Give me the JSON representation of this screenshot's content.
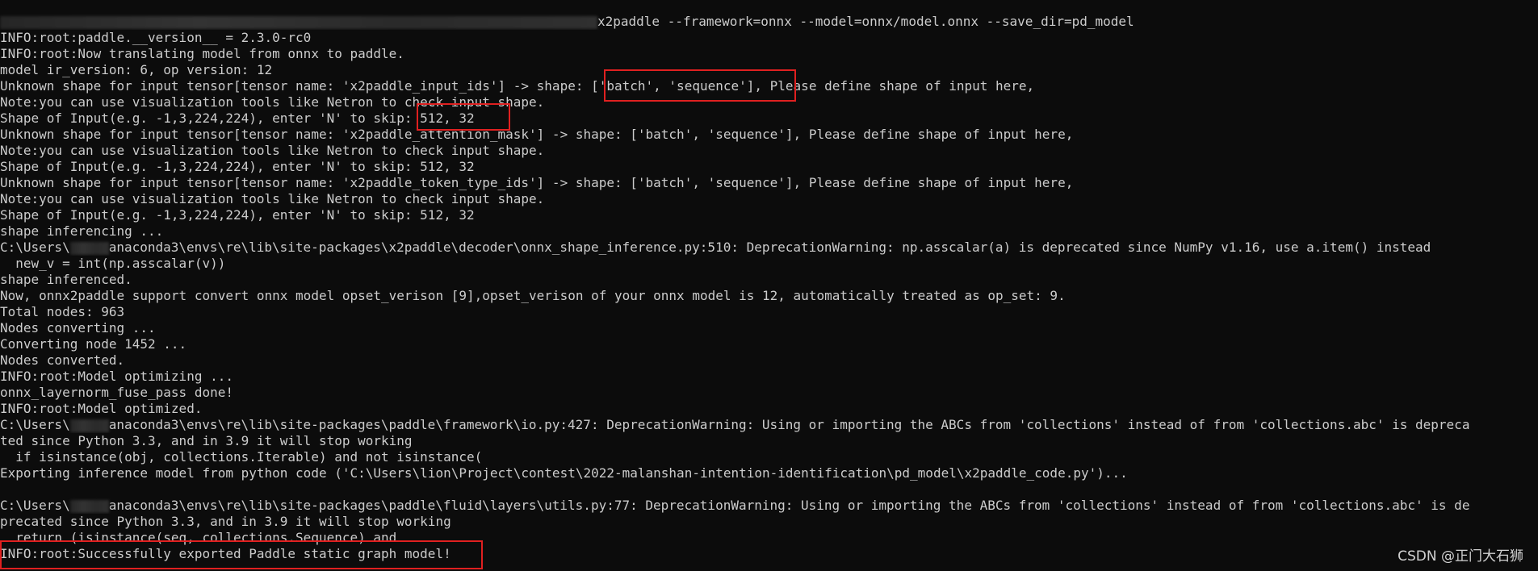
{
  "terminal": {
    "command": "x2paddle --framework=onnx --model=onnx/model.onnx --save_dir=pd_model",
    "lines": [
      "INFO:root:paddle.__version__ = 2.3.0-rc0",
      "INFO:root:Now translating model from onnx to paddle.",
      "model ir_version: 6, op version: 12",
      "Unknown shape for input tensor[tensor name: 'x2paddle_input_ids'] -> shape: ['batch', 'sequence'], Please define shape of input here,",
      "Note:you can use visualization tools like Netron to check input shape.",
      "Shape of Input(e.g. -1,3,224,224), enter 'N' to skip: 512, 32",
      "Unknown shape for input tensor[tensor name: 'x2paddle_attention_mask'] -> shape: ['batch', 'sequence'], Please define shape of input here,",
      "Note:you can use visualization tools like Netron to check input shape.",
      "Shape of Input(e.g. -1,3,224,224), enter 'N' to skip: 512, 32",
      "Unknown shape for input tensor[tensor name: 'x2paddle_token_type_ids'] -> shape: ['batch', 'sequence'], Please define shape of input here,",
      "Note:you can use visualization tools like Netron to check input shape.",
      "Shape of Input(e.g. -1,3,224,224), enter 'N' to skip: 512, 32",
      "shape inferencing ..."
    ],
    "warn1_prefix": "C:\\Users\\",
    "warn1_rest": "anaconda3\\envs\\re\\lib\\site-packages\\x2paddle\\decoder\\onnx_shape_inference.py:510: DeprecationWarning: np.asscalar(a) is deprecated since NumPy v1.16, use a.item() instead",
    "lines2": [
      "  new_v = int(np.asscalar(v))",
      "shape inferenced.",
      "Now, onnx2paddle support convert onnx model opset_verison [9],opset_verison of your onnx model is 12, automatically treated as op_set: 9.",
      "Total nodes: 963",
      "Nodes converting ...",
      "Converting node 1452 ...",
      "Nodes converted.",
      "INFO:root:Model optimizing ...",
      "onnx_layernorm_fuse_pass done!",
      "INFO:root:Model optimized."
    ],
    "warn2_prefix": "C:\\Users\\",
    "warn2_rest": "anaconda3\\envs\\re\\lib\\site-packages\\paddle\\framework\\io.py:427: DeprecationWarning: Using or importing the ABCs from 'collections' instead of from 'collections.abc' is depreca",
    "lines3": [
      "ted since Python 3.3, and in 3.9 it will stop working",
      "  if isinstance(obj, collections.Iterable) and not isinstance(",
      "Exporting inference model from python code ('C:\\Users\\lion\\Project\\contest\\2022-malanshan-intention-identification\\pd_model\\x2paddle_code.py')...",
      ""
    ],
    "warn3_prefix": "C:\\Users\\",
    "warn3_rest": "anaconda3\\envs\\re\\lib\\site-packages\\paddle\\fluid\\layers\\utils.py:77: DeprecationWarning: Using or importing the ABCs from 'collections' instead of from 'collections.abc' is de",
    "lines4": [
      "precated since Python 3.3, and in 3.9 it will stop working",
      "  return (isinstance(seq, collections.Sequence) and",
      "INFO:root:Successfully exported Paddle static graph model!"
    ]
  },
  "watermark": "CSDN @正门大石狮",
  "colors": {
    "background": "#0c0c0c",
    "text": "#cccccc",
    "highlight_box": "#e02020"
  }
}
